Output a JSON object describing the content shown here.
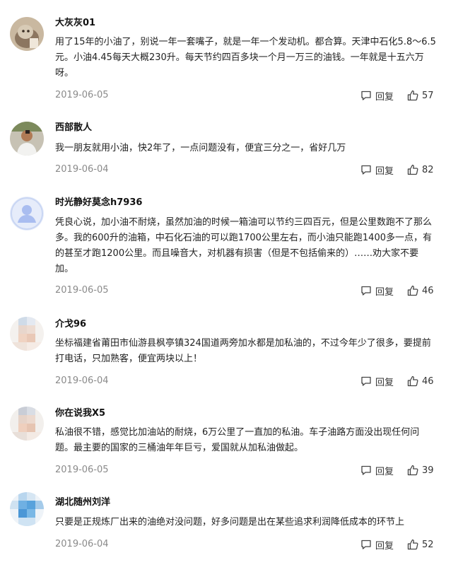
{
  "comments": [
    {
      "username": "大灰灰01",
      "text": "用了15年的小油了，别说一年一套嘴子，就是一年一个发动机。都合算。天津中石化5.8～6.5元。小油4.45每天大概230升。每天节约四百多块一个月一万三的油钱。一年就是十五六万呀。",
      "date": "2019-06-05",
      "reply_label": "回复",
      "likes": "57"
    },
    {
      "username": "西部散人",
      "text": "我一朋友就用小油，快2年了，一点问题没有，便宜三分之一，省好几万",
      "date": "2019-06-04",
      "reply_label": "回复",
      "likes": "82"
    },
    {
      "username": "时光静好莫念h7936",
      "text": "凭良心说，加小油不耐烧，虽然加油的时候一箱油可以节约三四百元，但是公里数跑不了那么多。我的600升的油箱，中石化石油的可以跑1700公里左右，而小油只能跑1400多一点，有的甚至才跑1200公里。而且噪音大，对机器有损害（但是不包括偷来的）……劝大家不要加。",
      "date": "2019-06-05",
      "reply_label": "回复",
      "likes": "46"
    },
    {
      "username": "介戈96",
      "text": "坐标福建省莆田市仙游县枫亭镇324国道两旁加水都是加私油的，不过今年少了很多，要提前打电话，只加熟客，便宜两块以上！",
      "date": "2019-06-04",
      "reply_label": "回复",
      "likes": "46"
    },
    {
      "username": "你在说我X5",
      "text": "私油很不错，感觉比加油站的耐烧，6万公里了一直加的私油。车子油路方面没出现任何问题。最主要的国家的三桶油年年巨亏，爱国就从加私油做起。",
      "date": "2019-06-05",
      "reply_label": "回复",
      "likes": "39"
    },
    {
      "username": "湖北随州刘洋",
      "text": "只要是正规炼厂出来的油绝对没问题，好多问题是出在某些追求利润降低成本的环节上",
      "date": "2019-06-04",
      "reply_label": "回复",
      "likes": "52"
    }
  ],
  "colors": {
    "username": "#111111",
    "text": "#222222",
    "date": "#8a8a8a",
    "action": "#333333"
  }
}
